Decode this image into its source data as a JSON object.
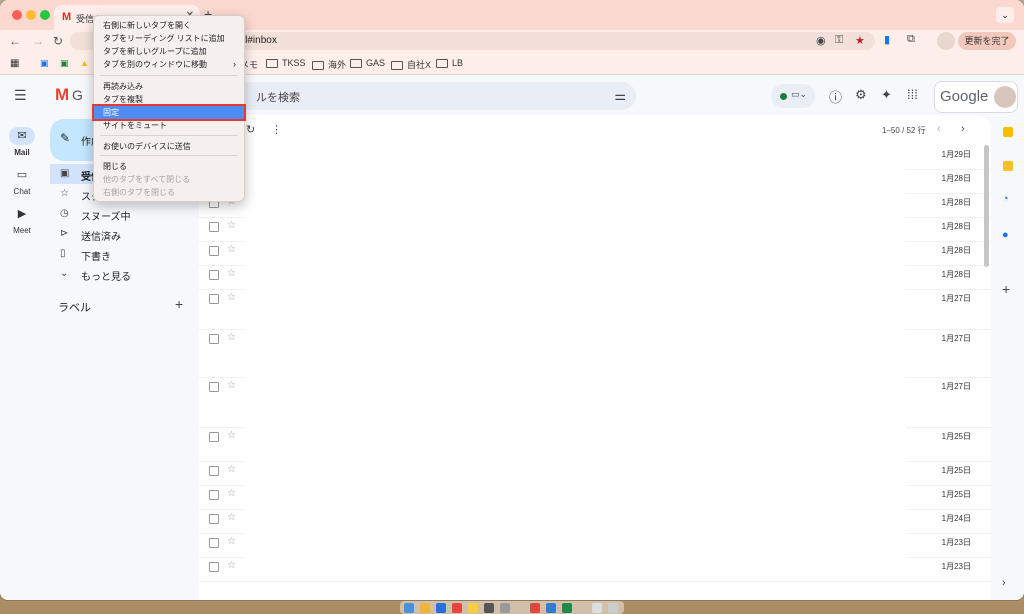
{
  "browser": {
    "tab_title": "受信トレイ",
    "tab_favicon": "M",
    "url": "gbl#inbox",
    "update_button": "更新を完了",
    "bookmarks": [
      "メモ",
      "TKSS",
      "海外",
      "GAS",
      "自社X",
      "LB"
    ]
  },
  "context_menu": {
    "items": [
      {
        "label": "右側に新しいタブを開く",
        "disabled": false
      },
      {
        "label": "タブをリーディング リストに追加",
        "disabled": false
      },
      {
        "label": "タブを新しいグループに追加",
        "disabled": false
      },
      {
        "label": "タブを別のウィンドウに移動",
        "disabled": false,
        "submenu": "›"
      },
      {
        "label": "再読み込み",
        "disabled": false
      },
      {
        "label": "タブを複製",
        "disabled": false
      },
      {
        "label": "固定",
        "disabled": false,
        "highlighted": true
      },
      {
        "label": "サイトをミュート",
        "disabled": false
      },
      {
        "label": "お使いのデバイスに送信",
        "disabled": false
      },
      {
        "label": "閉じる",
        "disabled": false
      },
      {
        "label": "他のタブをすべて閉じる",
        "disabled": true
      },
      {
        "label": "右側のタブを閉じる",
        "disabled": true
      }
    ]
  },
  "gmail": {
    "logo_text": "G",
    "search_placeholder": "ルを検索",
    "google_word": "Google",
    "rail": [
      {
        "label": "Mail",
        "icon": "mail-icon"
      },
      {
        "label": "Chat",
        "icon": "chat-icon"
      },
      {
        "label": "Meet",
        "icon": "meet-icon"
      }
    ],
    "compose_label": "作成",
    "nav": [
      {
        "label": "受信トレイ",
        "icon": "inbox-icon",
        "active": true
      },
      {
        "label": "スター付き",
        "icon": "star-icon"
      },
      {
        "label": "スヌーズ中",
        "icon": "clock-icon"
      },
      {
        "label": "送信済み",
        "icon": "send-icon"
      },
      {
        "label": "下書き",
        "icon": "draft-icon"
      },
      {
        "label": "もっと見る",
        "icon": "chevron-down-icon"
      }
    ],
    "labels_heading": "ラベル",
    "pager": "1–50 / 52 行",
    "dates": [
      "1月29日",
      "1月28日",
      "1月28日",
      "1月28日",
      "1月28日",
      "1月28日",
      "1月27日",
      "1月27日",
      "1月27日",
      "1月25日",
      "1月25日",
      "1月25日",
      "1月24日",
      "1月23日",
      "1月23日"
    ]
  }
}
